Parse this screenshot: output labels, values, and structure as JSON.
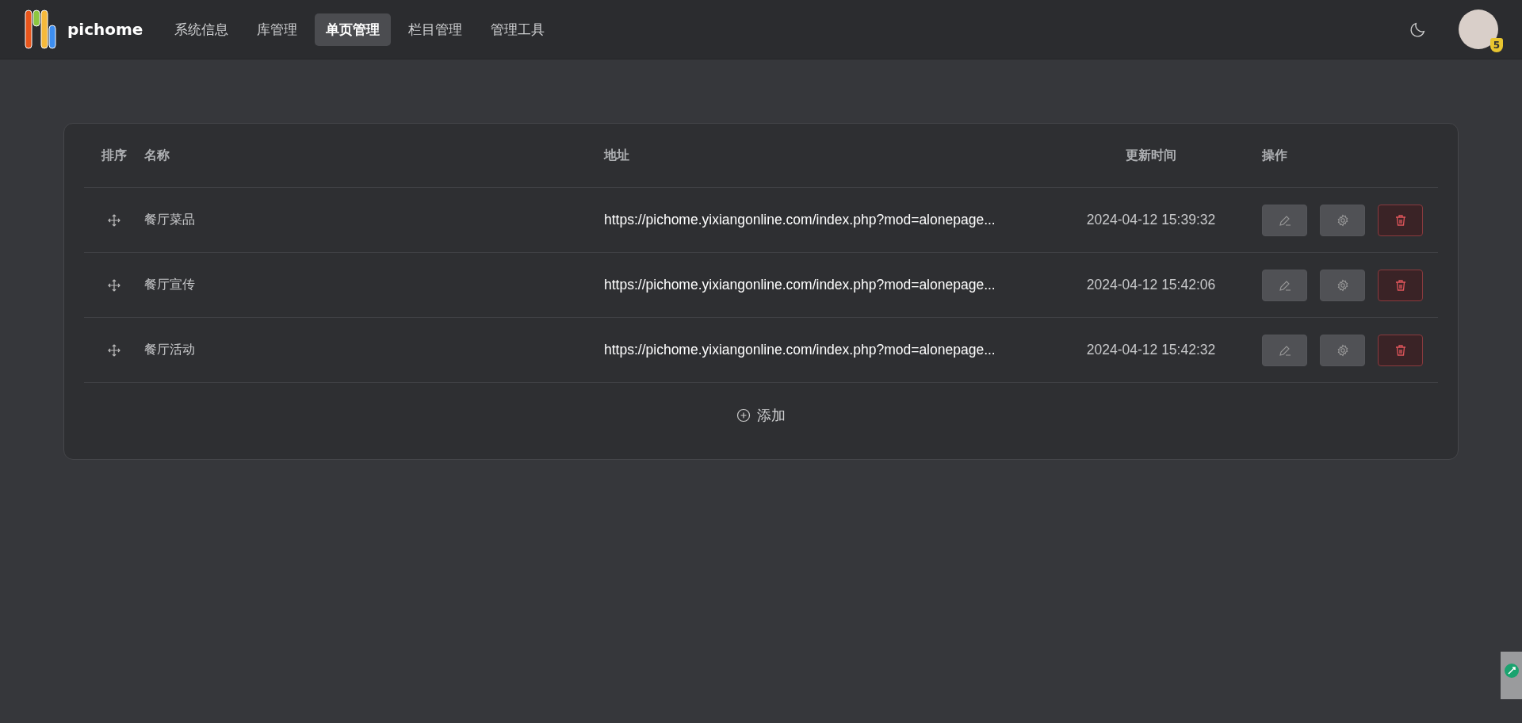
{
  "header": {
    "brand": "pichome",
    "nav": [
      {
        "label": "系统信息",
        "selected": false
      },
      {
        "label": "库管理",
        "selected": false
      },
      {
        "label": "单页管理",
        "selected": true
      },
      {
        "label": "栏目管理",
        "selected": false
      },
      {
        "label": "管理工具",
        "selected": false
      }
    ],
    "avatar_badge": "5"
  },
  "table": {
    "columns": [
      "排序",
      "名称",
      "地址",
      "更新时间",
      "操作"
    ],
    "rows": [
      {
        "name": "餐厅菜品",
        "url": "https://pichome.yixiangonline.com/index.php?mod=alonepage...",
        "updated": "2024-04-12 15:39:32"
      },
      {
        "name": "餐厅宣传",
        "url": "https://pichome.yixiangonline.com/index.php?mod=alonepage...",
        "updated": "2024-04-12 15:42:06"
      },
      {
        "name": "餐厅活动",
        "url": "https://pichome.yixiangonline.com/index.php?mod=alonepage...",
        "updated": "2024-04-12 15:42:32"
      }
    ],
    "add_label": "添加"
  }
}
